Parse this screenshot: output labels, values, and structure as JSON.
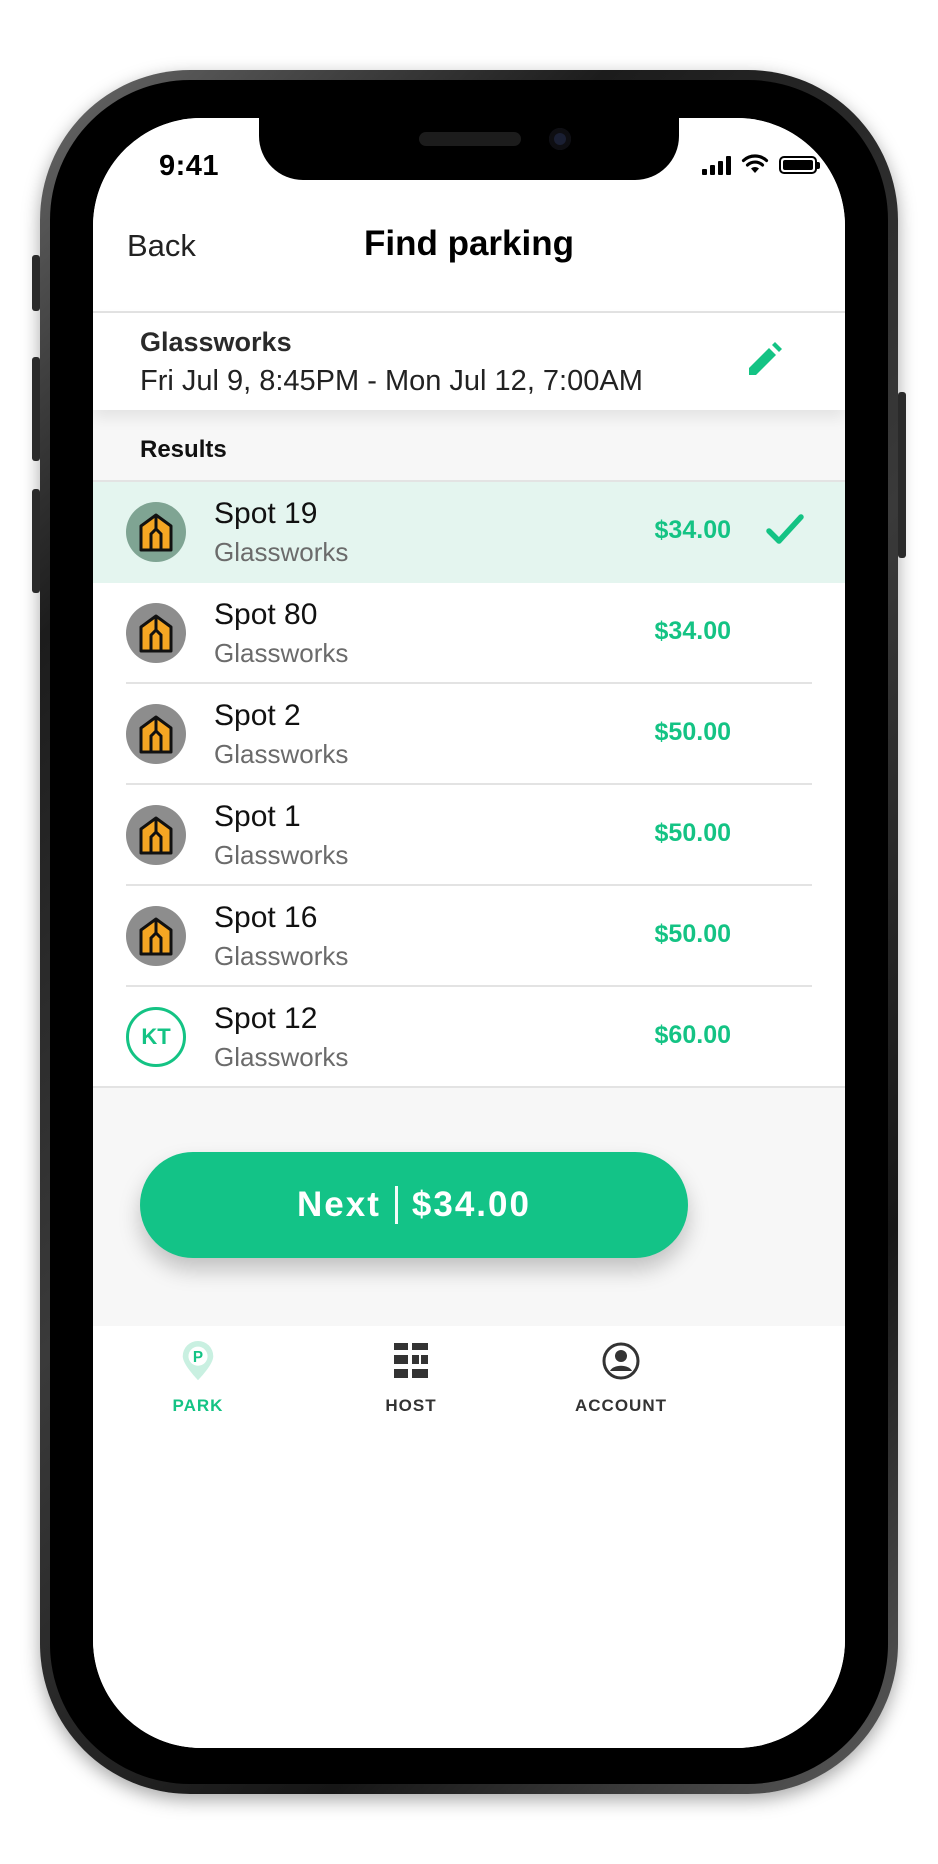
{
  "status_bar": {
    "time": "9:41"
  },
  "nav": {
    "back_label": "Back",
    "title": "Find parking"
  },
  "search": {
    "location": "Glassworks",
    "dates": "Fri Jul 9, 8:45PM - Mon Jul 12, 7:00AM",
    "edit_icon": "pencil-icon"
  },
  "results": {
    "header": "Results",
    "items": [
      {
        "name": "Spot 19",
        "location": "Glassworks",
        "price": "$34.00",
        "selected": true,
        "avatar": "building-icon"
      },
      {
        "name": "Spot 80",
        "location": "Glassworks",
        "price": "$34.00",
        "selected": false,
        "avatar": "building-icon"
      },
      {
        "name": "Spot 2",
        "location": "Glassworks",
        "price": "$50.00",
        "selected": false,
        "avatar": "building-icon"
      },
      {
        "name": "Spot 1",
        "location": "Glassworks",
        "price": "$50.00",
        "selected": false,
        "avatar": "building-icon"
      },
      {
        "name": "Spot 16",
        "location": "Glassworks",
        "price": "$50.00",
        "selected": false,
        "avatar": "building-icon"
      },
      {
        "name": "Spot 12",
        "location": "Glassworks",
        "price": "$60.00",
        "selected": false,
        "avatar": "initials",
        "initials": "KT"
      }
    ]
  },
  "next_button": {
    "label": "Next",
    "price": "$34.00"
  },
  "tabs": [
    {
      "label": "PARK",
      "icon": "parking-pin-icon",
      "active": true
    },
    {
      "label": "HOST",
      "icon": "host-grid-icon",
      "active": false
    },
    {
      "label": "ACCOUNT",
      "icon": "account-icon",
      "active": false
    }
  ],
  "colors": {
    "accent": "#14c384",
    "selected_row": "#e4f5ef",
    "avatar_orange": "#f5a623"
  }
}
